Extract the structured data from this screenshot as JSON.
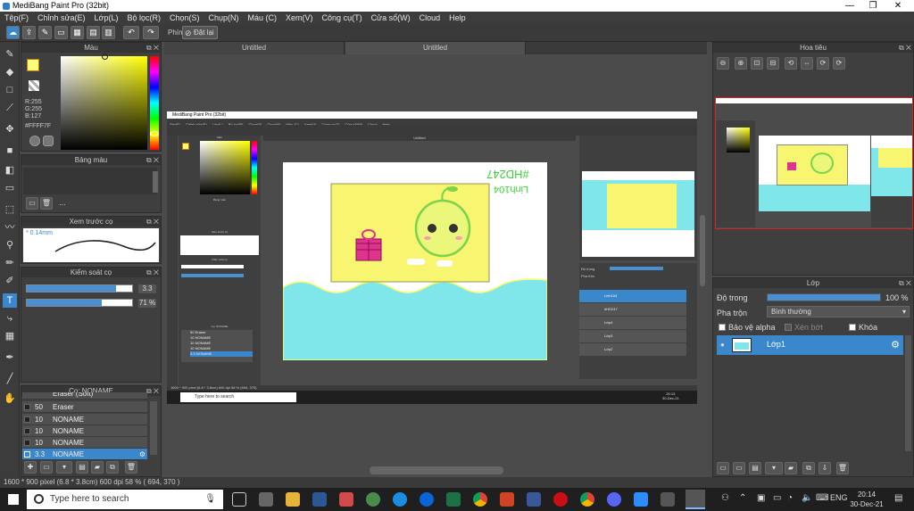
{
  "window": {
    "title": "MediBang Paint Pro (32bit)",
    "minimize": "—",
    "maximize": "❐",
    "close": "✕"
  },
  "menu": [
    "Tệp(F)",
    "Chỉnh sửa(E)",
    "Lớp(L)",
    "Bộ lọc(R)",
    "Chọn(S)",
    "Chụp(N)",
    "Máu (C)",
    "Xem(V)",
    "Công cụ(T)",
    "Cửa sổ(W)",
    "Cloud",
    "Help"
  ],
  "toolbar": {
    "phim_label": "Phím",
    "reset_label": "Đặt lại"
  },
  "color_panel": {
    "title": "Màu",
    "r": "R:255",
    "g": "G:255",
    "b": "B:127",
    "hex": "#FFFF7F",
    "primary": "#FFFF7F",
    "secondary": "#ffffff"
  },
  "swatch_panel": {
    "title": "Bảng màu",
    "more": "..."
  },
  "brush_preview": {
    "title": "Xem trước cọ",
    "size": "0.14mm"
  },
  "brush_control": {
    "title": "Kiểm soát cọ",
    "size_value": "3.3",
    "size_level": 0.85,
    "opacity_value": "71 %",
    "opacity_level": 0.71
  },
  "brush_list": {
    "title": "Cọ: NONAME",
    "items": [
      {
        "size": "",
        "name": "Eraser (Soft)"
      },
      {
        "size": "50",
        "name": "Eraser"
      },
      {
        "size": "10",
        "name": "NONAME"
      },
      {
        "size": "10",
        "name": "NONAME"
      },
      {
        "size": "10",
        "name": "NONAME"
      },
      {
        "size": "3.3",
        "name": "NONAME"
      }
    ]
  },
  "tabs": [
    "Untitled",
    "Untitled"
  ],
  "nested": {
    "title": "MediBang Paint Pro (32bit)",
    "menu": [
      "Tệp(F)",
      "Chỉnh sửa(E)",
      "Lớp(L)",
      "Bộ lọc(R)",
      "Chọn(S)",
      "Chụp(N)",
      "Máu (C)",
      "Xem(V)",
      "Công cụ(T)",
      "Cửa sổ(W)",
      "Cloud",
      "Help"
    ],
    "tab": "Untitled",
    "layers": [
      "Linh104",
      "#HD247",
      "Lớp4",
      "Lớp3",
      "Lớp2"
    ],
    "brushes": [
      {
        "size": "",
        "name": "Eraser (Soft)"
      },
      {
        "size": "50",
        "name": "Eraser"
      },
      {
        "size": "10",
        "name": "NONAME"
      },
      {
        "size": "10",
        "name": "NONAME"
      },
      {
        "size": "10",
        "name": "NONAME"
      },
      {
        "size": "3.3",
        "name": "NONAME"
      }
    ],
    "search": "Type here to search",
    "time": "20:13",
    "date": "30-Dec-21",
    "status": "1600 * 900 pixel (6.8 * 3.8cm) 600 dpi 58 % (694, 370)",
    "blend_label": "Pha trộn",
    "opacity_label": "Độ trong",
    "brush_label": "Cọ: NONAME",
    "color_label": "Màu",
    "control_label": "Kiểm soát cọ",
    "swatch_label": "Bảng màu",
    "preview_label": "Xem trước cọ"
  },
  "canvas_text": {
    "name": "Linh104",
    "tag": "#HD247"
  },
  "navigator": {
    "title": "Hoa tiêu"
  },
  "layer_panel": {
    "title": "Lớp",
    "opacity_label": "Độ trong",
    "opacity_value": "100 %",
    "opacity_level": 1.0,
    "blend_label": "Pha trộn",
    "blend_value": "Bình thường",
    "protect_alpha": "Bảo vệ alpha",
    "clip": "Xén bớt",
    "lock": "Khóa",
    "layers": [
      {
        "name": "Lớp1"
      }
    ]
  },
  "status_bar": "1600 * 900 pixel  (6.8 * 3.8cm)  600 dpi  58 %  ( 694, 370 )",
  "taskbar": {
    "search_placeholder": "Type here to search",
    "lang": "ENG",
    "time": "20:14",
    "date": "30-Dec-21"
  }
}
